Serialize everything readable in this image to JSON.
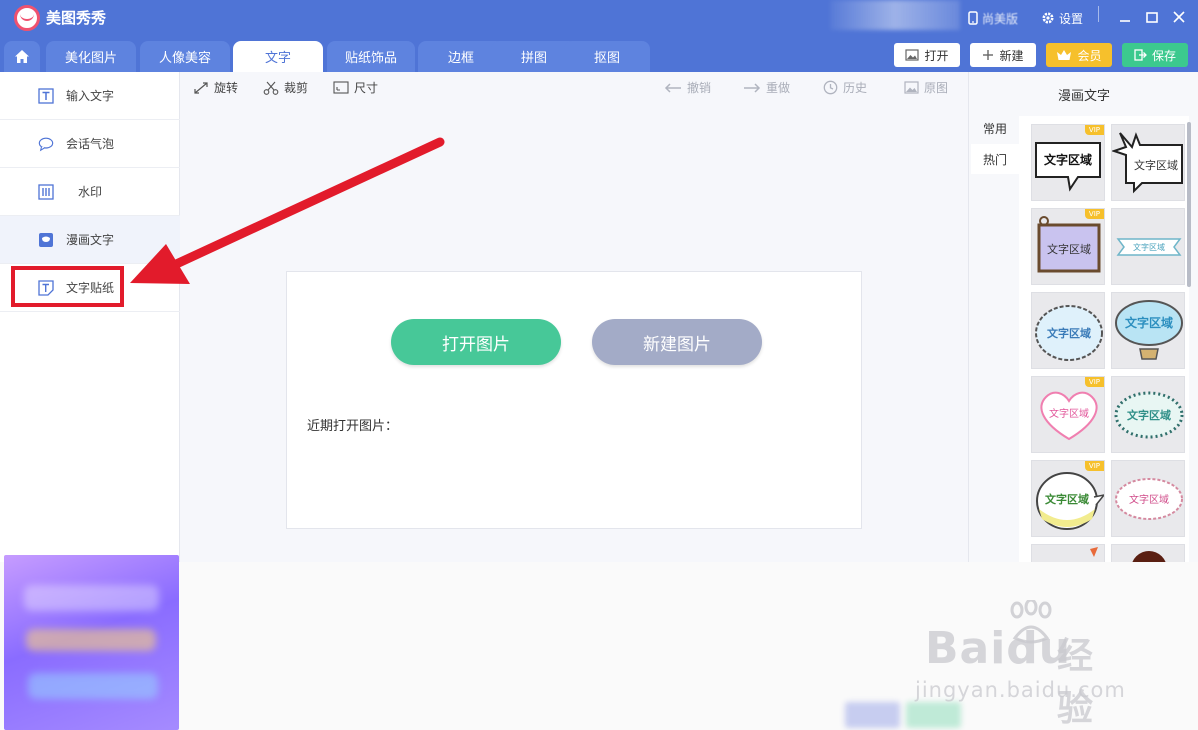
{
  "app": {
    "title": "美图秀秀"
  },
  "titlebar": {
    "version_label": "尚美版",
    "settings_label": "设置"
  },
  "tabs": [
    {
      "label": "美化图片",
      "active": false
    },
    {
      "label": "人像美容",
      "active": false
    },
    {
      "label": "文字",
      "active": true
    },
    {
      "label": "贴纸饰品",
      "active": false
    },
    {
      "label": "边框",
      "active": false
    },
    {
      "label": "拼图",
      "active": false
    },
    {
      "label": "抠图",
      "active": false
    }
  ],
  "header_buttons": {
    "open": "打开",
    "new": "新建",
    "vip": "会员",
    "save": "保存"
  },
  "sidebar": {
    "items": [
      {
        "label": "输入文字",
        "icon": "text-t-icon"
      },
      {
        "label": "会话气泡",
        "icon": "speech-bubble-icon"
      },
      {
        "label": "水印",
        "icon": "watermark-icon"
      },
      {
        "label": "漫画文字",
        "icon": "comic-text-icon",
        "active": true
      },
      {
        "label": "文字贴纸",
        "icon": "text-sticker-icon",
        "highlighted": true
      }
    ]
  },
  "toolbar": {
    "rotate": "旋转",
    "crop": "裁剪",
    "size": "尺寸",
    "undo": "撤销",
    "redo": "重做",
    "history": "历史",
    "original": "原图"
  },
  "canvas": {
    "open_image_button": "打开图片",
    "new_image_button": "新建图片",
    "recent_label": "近期打开图片："
  },
  "right_panel": {
    "title": "漫画文字",
    "tabs": [
      "常用",
      "热门"
    ],
    "thumbnails": [
      {
        "text": "文字区域",
        "vip": true
      },
      {
        "text": "文字区域",
        "vip": false
      },
      {
        "text": "文字区域",
        "vip": true
      },
      {
        "text": "文字区域",
        "vip": false
      },
      {
        "text": "文字区域",
        "vip": false
      },
      {
        "text": "文字区域",
        "vip": false
      },
      {
        "text": "文字区域",
        "vip": true
      },
      {
        "text": "文字区域",
        "vip": false
      },
      {
        "text": "文字区域",
        "vip": true
      },
      {
        "text": "文字区域",
        "vip": false
      }
    ],
    "vip_badge": "VIP"
  },
  "watermark": {
    "brand": "Baidu",
    "cn": "经验",
    "url": "jingyan.baidu.com"
  },
  "colors": {
    "accent": "#4f74d6",
    "open_button": "#47c898",
    "new_button": "#a3abc7",
    "highlight": "#e21b2b"
  }
}
